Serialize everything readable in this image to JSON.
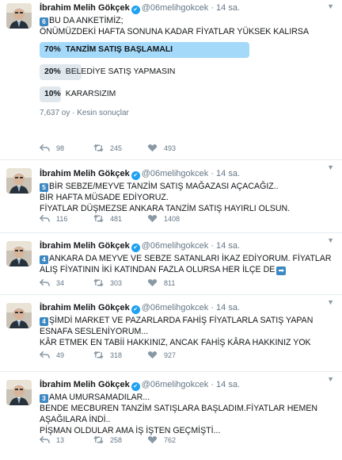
{
  "colors": {
    "link": "#1da1f2",
    "winner_fill": "#a4d9f9",
    "bar_fill": "#e1e8ed",
    "badge": "#3b88c3"
  },
  "tweets": [
    {
      "name": "İbrahim Melih Gökçek",
      "handle": "@06melihgokcek",
      "dot": "·",
      "time": "14 sa.",
      "badge": "6",
      "lines": [
        "BU DA ANKETİMİZ;",
        "ÖNÜMÜZDEKİ HAFTA SONUNA KADAR FİYATLAR YÜKSEK KALIRSA"
      ],
      "poll": {
        "options": [
          {
            "pct_label": "70%",
            "pct": 70,
            "text": "TANZİM SATIŞ BAŞLAMALI"
          },
          {
            "pct_label": "20%",
            "pct": 20,
            "text": "BELEDİYE SATIŞ YAPMASIN"
          },
          {
            "pct_label": "10%",
            "pct": 10,
            "text": "KARARSIZIM"
          }
        ],
        "meta": "7,637 oy · Kesin sonuçlar"
      },
      "replies": "98",
      "retweets": "245",
      "likes": "493"
    },
    {
      "name": "İbrahim Melih Gökçek",
      "handle": "@06melihgokcek",
      "dot": "·",
      "time": "14 sa.",
      "badge": "5",
      "lines": [
        "BİR SEBZE/MEYVE TANZİM SATIŞ MAĞAZASI AÇACAĞIZ..",
        "BİR HAFTA MÜSADE EDİYORUZ.",
        "FİYATLAR DÜŞMEZSE ANKARA TANZİM SATIŞ HAYIRLI OLSUN."
      ],
      "replies": "116",
      "retweets": "481",
      "likes": "1408"
    },
    {
      "name": "İbrahim Melih Gökçek",
      "handle": "@06melihgokcek",
      "dot": "·",
      "time": "14 sa.",
      "badge": "4",
      "lines": [
        "ANKARA DA MEYVE VE SEBZE SATANLARI İKAZ EDİYORUM. FİYATLAR",
        "ALIŞ FİYATININ İKİ KATINDAN FAZLA OLURSA HER İLÇE DE"
      ],
      "arrow": "➡",
      "replies": "34",
      "retweets": "303",
      "likes": "811"
    },
    {
      "name": "İbrahim Melih Gökçek",
      "handle": "@06melihgokcek",
      "dot": "·",
      "time": "14 sa.",
      "badge": "4",
      "lines": [
        "ŞİMDİ MARKET VE PAZARLARDA FAHİŞ FİYATLARLA SATIŞ YAPAN",
        "ESNAFA SESLENİYORUM...",
        "KÂR ETMEK EN TABİİ HAKKINIZ, ANCAK FAHİŞ KÂRA HAKKINIZ YOK"
      ],
      "replies": "49",
      "retweets": "318",
      "likes": "927"
    },
    {
      "name": "İbrahim Melih Gökçek",
      "handle": "@06melihgokcek",
      "dot": "·",
      "time": "14 sa.",
      "badge": "3",
      "lines": [
        "AMA UMURSAMADILAR...",
        "BENDE MECBUREN TANZİM SATIŞLARA BAŞLADIM.FİYATLAR HEMEN",
        "AŞAĞILARA İNDİ..",
        "PİŞMAN OLDULAR AMA İŞ İŞTEN GEÇMİŞTİ..."
      ],
      "replies": "13",
      "retweets": "258",
      "likes": "762"
    }
  ]
}
